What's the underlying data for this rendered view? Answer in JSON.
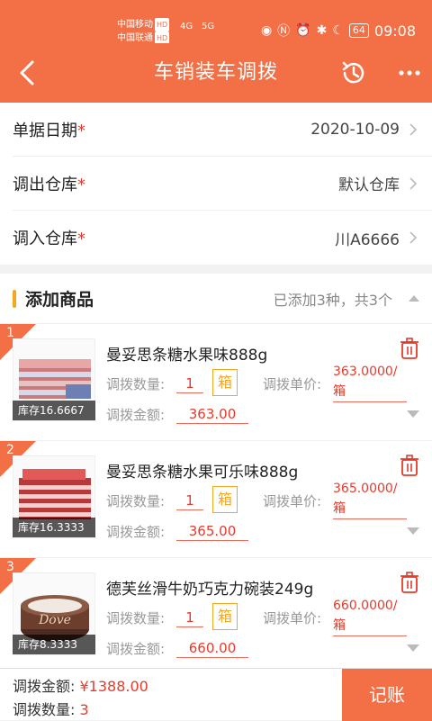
{
  "status": {
    "carrier1": "中国移动",
    "carrier2": "中国联通",
    "hd": "HD",
    "net1": "4G",
    "net2": "5G",
    "battery": "64",
    "time": "09:08"
  },
  "nav": {
    "title": "车销装车调拨"
  },
  "form": {
    "rows": [
      {
        "label": "单据日期",
        "required": "*",
        "value": "2020-10-09"
      },
      {
        "label": "调出仓库",
        "required": "*",
        "value": "默认仓库"
      },
      {
        "label": "调入仓库",
        "required": "*",
        "value": "川A6666"
      }
    ]
  },
  "section": {
    "title": "添加商品",
    "summary": "已添加3种，共3个"
  },
  "labels": {
    "qty": "调拨数量:",
    "price": "调拨单价:",
    "amount": "调拨金额:"
  },
  "items": [
    {
      "index": "1",
      "name": "曼妥思条糖水果味888g",
      "stock": "库存16.6667",
      "qty": "1",
      "unit": "箱",
      "price": "363.0000/",
      "price_unit": "箱",
      "amount": "363.00"
    },
    {
      "index": "2",
      "name": "曼妥思条糖水果可乐味888g",
      "stock": "库存16.3333",
      "qty": "1",
      "unit": "箱",
      "price": "365.0000/",
      "price_unit": "箱",
      "amount": "365.00"
    },
    {
      "index": "3",
      "name": "德芙丝滑牛奶巧克力碗装249g",
      "stock": "库存8.3333",
      "qty": "1",
      "unit": "箱",
      "price": "660.0000/",
      "price_unit": "箱",
      "amount": "660.00"
    }
  ],
  "footer": {
    "amount_label": "调拨金额:",
    "amount_value": "¥1388.00",
    "qty_label": "调拨数量:",
    "qty_value": "3",
    "save": "记账"
  },
  "colors": {
    "brand": "#f36f45",
    "accent": "#f5a623",
    "red": "#e53b2c"
  },
  "icons": [
    "back-arrow-icon",
    "history-icon",
    "more-icon",
    "chevron-right-icon",
    "trash-icon",
    "caret-up-icon",
    "caret-down-icon"
  ]
}
